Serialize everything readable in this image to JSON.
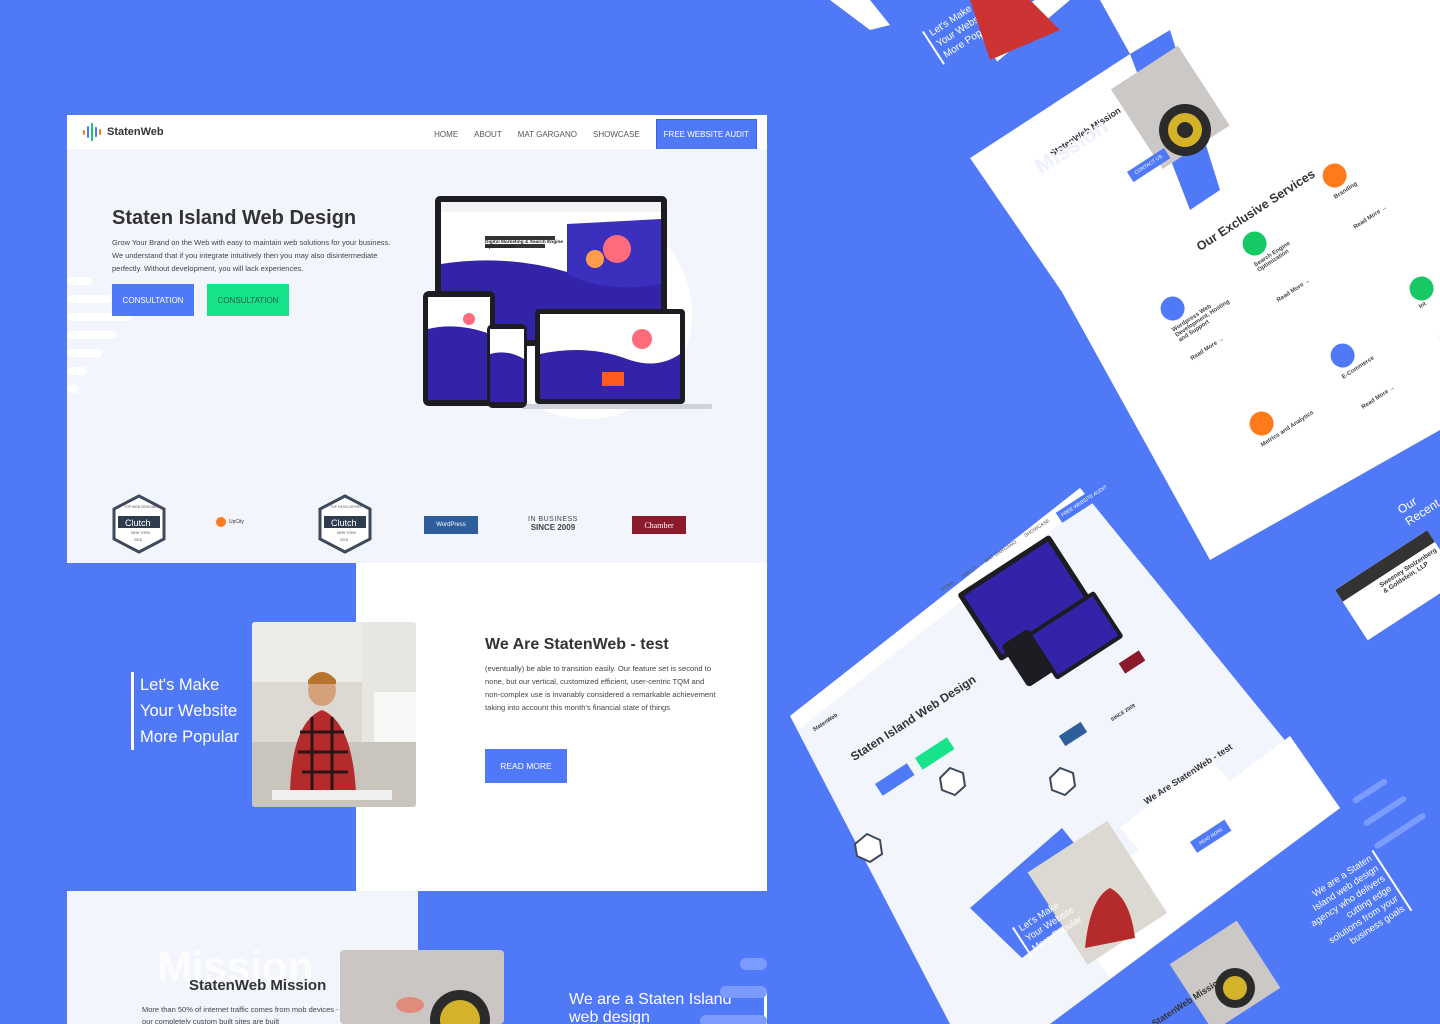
{
  "brand": {
    "name": "StatenWeb"
  },
  "nav": {
    "items": [
      "HOME",
      "ABOUT",
      "MAT GARGANO",
      "SHOWCASE"
    ],
    "cta": "FREE WEBSITE AUDIT"
  },
  "hero": {
    "title": "Staten Island Web Design",
    "body": "Grow Your Brand on the Web with easy to maintain web solutions for your business. We understand that if you integrate intuitively then you may also disintermediate perfectly. Without development, you will lack experiences.",
    "button1": "CONSULTATION",
    "button2": "CONSULTATION",
    "mockup_headline": "Digital Marketing & Search Engine Optimization!"
  },
  "badges": {
    "clutch1": {
      "top": "TOP WEB DESIGNERS",
      "name": "Clutch",
      "loc": "NEW YORK",
      "year": "2018"
    },
    "upcity": "UpCity",
    "clutch2": {
      "top": "TOP DEVELOPERS",
      "name": "Clutch",
      "loc": "NEW YORK",
      "year": "2018"
    },
    "wordpress": "WordPress",
    "inbusiness": {
      "line1": "IN BUSINESS",
      "line2": "SINCE 2009"
    },
    "chamber": "Chamber"
  },
  "about": {
    "quote_lines": [
      "Let's Make",
      "Your Website",
      "More Popular"
    ],
    "title": "We Are StatenWeb - test",
    "body": "(eventually) be able to transition easily. Our feature set is second to none, but our vertical, customized efficient, user-centric TQM and non-complex use is invariably considered a remarkable achievement taking into account this month's financial state of things",
    "button": "READ MORE"
  },
  "mission": {
    "watermark": "Mission",
    "title": "StatenWeb Mission",
    "body": "More than 50% of internet traffic comes from mob devices - our completely custom built sites are built",
    "quote": "We are a Staten Island web design"
  },
  "right_top": {
    "quote_lines": [
      "We are a Staten",
      "Island web design",
      "agency who delivers",
      "cutting edge",
      "solutions from your",
      "business goals"
    ],
    "left_quote": [
      "Let's Make",
      "Your Website",
      "More Popular"
    ],
    "mission_title": "StatenWeb Mission",
    "mission_watermark": "Mission",
    "contact": "CONTACT US",
    "services_title": "Our Exclusive Services",
    "services": [
      {
        "name": "Wordpress Web Development, Hosting and Support",
        "link": "Read More →",
        "color": "#5079f8"
      },
      {
        "name": "Search Engine Optimization",
        "link": "Read More →",
        "color": "#17c964"
      },
      {
        "name": "Branding",
        "link": "Read More →",
        "color": "#ff7a1a"
      },
      {
        "name": "Metrics and Analytics",
        "link": "",
        "color": "#ff7a1a"
      },
      {
        "name": "E-Commerce",
        "link": "Read More →",
        "color": "#5079f8"
      },
      {
        "name": "Int",
        "link": "",
        "color": "#17c964"
      }
    ],
    "recent": "Our Recent",
    "project": "Sweeney Stolzenberg & Goldstein, LLP"
  },
  "right_bottom": {
    "nav": [
      "HOME",
      "ABOUT",
      "MAT GARGANO",
      "SHOWCASE",
      "FREE WEBSITE AUDIT"
    ],
    "title": "Staten Island Web Design",
    "about_title": "We Are StatenWeb - test",
    "read_more": "READ MORE",
    "quote1": [
      "Let's Make",
      "Your Website",
      "More Popular"
    ],
    "quote2": [
      "We are a Staten",
      "Island web design",
      "agency who delivers",
      "cutting edge",
      "solutions from your",
      "business goals"
    ],
    "mission": "StatenWeb Missio",
    "since": "SINCE 2009"
  },
  "colors": {
    "accent": "#5079f8",
    "green": "#17e38a",
    "orange": "#ff7a1a",
    "text": "#333333",
    "panel": "#f3f5fd"
  }
}
